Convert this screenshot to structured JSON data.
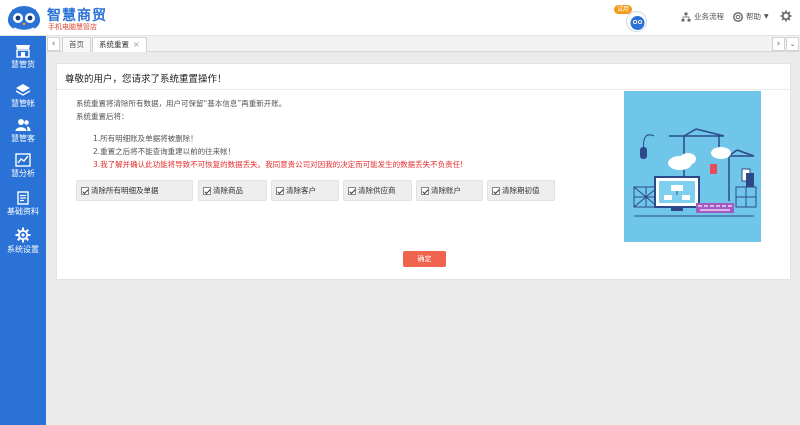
{
  "brand": {
    "title": "智慧商贸",
    "subtitle": "手机电脑慧管店"
  },
  "header": {
    "badge": "试用",
    "flow_label": "业务流程",
    "help_label": "帮助"
  },
  "sidebar": {
    "items": [
      {
        "label": "慧管货",
        "icon": "store-icon"
      },
      {
        "label": "慧管帐",
        "icon": "ledger-icon"
      },
      {
        "label": "慧管客",
        "icon": "customers-icon"
      },
      {
        "label": "慧分析",
        "icon": "chart-icon"
      },
      {
        "label": "基础资料",
        "icon": "document-icon"
      },
      {
        "label": "系统设置",
        "icon": "gear-icon"
      }
    ]
  },
  "tabs": [
    {
      "label": "首页",
      "active": false
    },
    {
      "label": "系统重置",
      "active": true
    }
  ],
  "reset": {
    "heading": "尊敬的用户，您请求了系统重置操作！",
    "line1": "系统重置将清除所有数据，用户可保留“基本信息”再重新开账。",
    "line2": "系统重置后将：",
    "point1": "1.所有明细账及单据将被删除！",
    "point2": "2.重置之后将不能查询重建以前的往来帐！",
    "point3": "3.我了解并确认此功能将导致不可恢复的数据丢失。我同意贵公司对因我的决定而可能发生的数据丢失不负责任!",
    "options": [
      {
        "label": "清除所有明细及单据",
        "checked": true
      },
      {
        "label": "清除商品",
        "checked": true
      },
      {
        "label": "清除客户",
        "checked": true
      },
      {
        "label": "清除供应商",
        "checked": true
      },
      {
        "label": "清除账户",
        "checked": true
      },
      {
        "label": "清除期初值",
        "checked": true
      }
    ],
    "confirm_label": "确定"
  },
  "colors": {
    "primary": "#2a72d6",
    "accent": "#f0634d",
    "warning": "#e53030",
    "illustration_bg": "#6fc6e8"
  }
}
